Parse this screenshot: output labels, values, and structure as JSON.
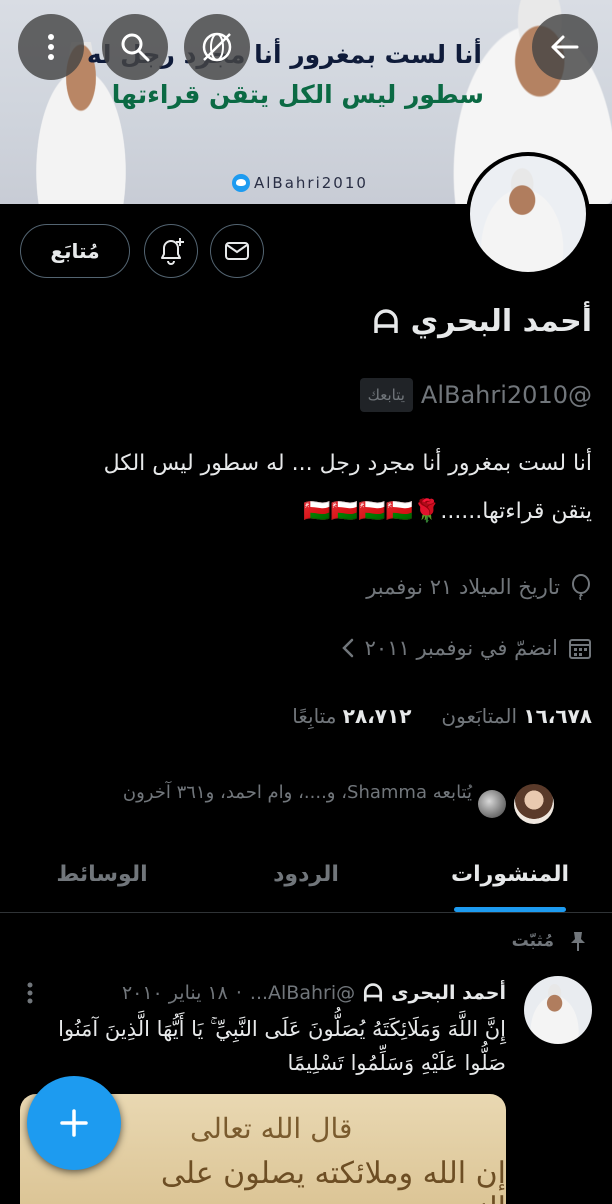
{
  "banner": {
    "line1": "أنا لست بمغرور أنا مجرد رجل له",
    "line2": "سطور ليس الكل يتقن قراءتها",
    "handle": "AlBahri2010"
  },
  "profile": {
    "name": "أحمد البحري",
    "handle": "@AlBahri2010",
    "follows_you": "يتابعك",
    "bio_line1": "أنا لست بمغرور أنا مجرد رجل ... له سطور ليس الكل",
    "bio_line2": "يتقن قراءتها......🌹🇴🇲🇴🇲🇴🇲🇴🇲",
    "birthday": "تاريخ الميلاد ٢١ نوفمبر",
    "joined": "انضمّ في نوفمبر ٢٠١١",
    "following_count": "١٦،٦٧٨",
    "following_label": "المتابَعون",
    "followers_count": "٢٨،٧١٢",
    "followers_label": "متابِعًا",
    "followed_by": "يُتابعه Shamma، و....، وام احمد، و٣٦١ آخرون"
  },
  "actions": {
    "follow_label": "مُتابَع"
  },
  "tabs": [
    {
      "label": "المنشورات",
      "active": true
    },
    {
      "label": "الردود",
      "active": false
    },
    {
      "label": "الوسائط",
      "active": false
    }
  ],
  "tweet": {
    "pinned_label": "مُثبّت",
    "author": "أحمد البحرى",
    "handle": "@AlBahri...",
    "date": "١٨ يناير ٢٠١٠",
    "text": "إِنَّ اللَّهَ وَمَلَائِكَتَهُ يُصَلُّونَ عَلَى النَّبِيِّ ۚ يَا أَيُّهَا الَّذِينَ آمَنُوا صَلُّوا عَلَيْهِ وَسَلِّمُوا تَسْلِيمًا",
    "image_text1": "قال الله تعالى",
    "image_text2": "إن الله وملائكته يصلون على النبي"
  },
  "colors": {
    "accent": "#1d9bf0",
    "muted": "#71767b",
    "text": "#e7e9ea"
  }
}
